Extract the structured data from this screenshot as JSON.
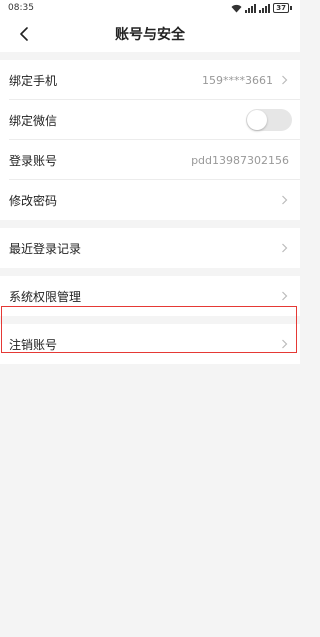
{
  "status_bar": {
    "time": "08:35",
    "battery": "37",
    "icons": [
      "wifi-icon",
      "signal-icon",
      "signal-icon"
    ]
  },
  "header": {
    "title": "账号与安全",
    "back_icon": "chevron-left-icon"
  },
  "settings": {
    "bind_phone": {
      "label": "绑定手机",
      "value": "159****3661"
    },
    "bind_wechat": {
      "label": "绑定微信",
      "toggle_on": false
    },
    "login_account": {
      "label": "登录账号",
      "value": "pdd13987302156"
    },
    "change_password": {
      "label": "修改密码"
    },
    "recent_login": {
      "label": "最近登录记录"
    },
    "permissions": {
      "label": "系统权限管理"
    },
    "cancel_account": {
      "label": "注销账号"
    }
  },
  "colors": {
    "highlight_border": "#e53935",
    "background": "#f4f4f4",
    "toggle_off": "#e6e6e6"
  }
}
